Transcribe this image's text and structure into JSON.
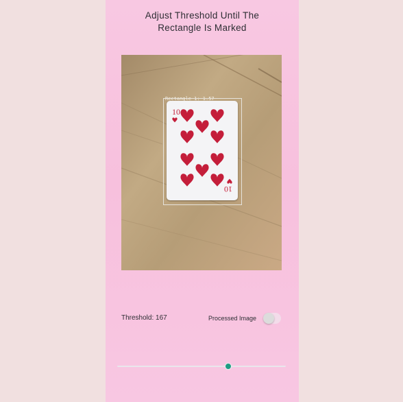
{
  "title": {
    "line1": "Adjust Threshold Until  The",
    "line2": "Rectangle Is Marked"
  },
  "camera": {
    "detection_label": "Rectangle 1: 1.57"
  },
  "controls": {
    "threshold_label": "Threshold: 167",
    "processed_label": "Processed Image",
    "processed_on": false
  },
  "slider": {
    "value_fraction": 0.66,
    "thumb_color": "#1f9c83"
  },
  "colors": {
    "page_bg": "#f1e0e0",
    "phone_bg": "#f8c8e2",
    "heart_red": "#c41e3a"
  }
}
